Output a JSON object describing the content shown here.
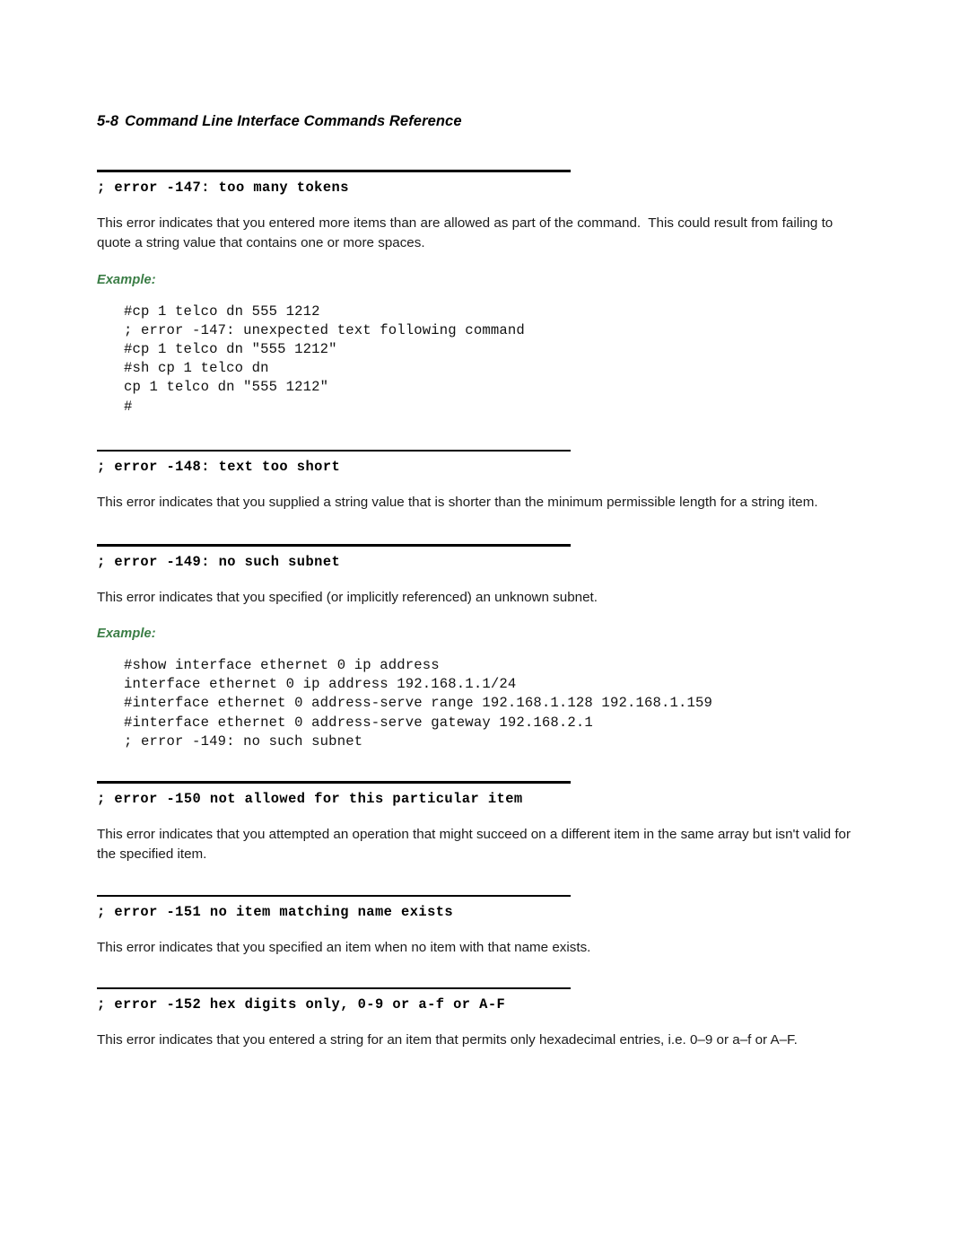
{
  "header": {
    "folio": "5-8",
    "title": "Command Line Interface Commands Reference"
  },
  "labels": {
    "example": "Example:"
  },
  "colors": {
    "example_green": "#3a7d45",
    "rule_black": "#000000",
    "body_text": "#1b1b1b"
  },
  "sections": [
    {
      "heading": "; error -147: too many tokens",
      "body": "This error indicates that you entered more items than are allowed as part of the command.  This could result from failing to quote a string value that contains one or more spaces.",
      "example_label": "Example:",
      "code": "#cp 1 telco dn 555 1212\n; error -147: unexpected text following command\n#cp 1 telco dn \"555 1212\"\n#sh cp 1 telco dn\ncp 1 telco dn \"555 1212\"\n#"
    },
    {
      "heading": "; error -148: text too short",
      "body": "This error indicates that you supplied a string value that is shorter than the minimum permissible length for a string item."
    },
    {
      "heading": "; error -149: no such subnet",
      "body": "This error indicates that you specified (or implicitly referenced) an unknown subnet.",
      "example_label": "Example:",
      "code": "#show interface ethernet 0 ip address\ninterface ethernet 0 ip address 192.168.1.1/24\n#interface ethernet 0 address-serve range 192.168.1.128 192.168.1.159\n#interface ethernet 0 address-serve gateway 192.168.2.1\n; error -149: no such subnet"
    },
    {
      "heading": "; error -150 not allowed for this particular item",
      "body": "This error indicates that you attempted an operation that might succeed on a different item in the same array but isn't valid for the specified item."
    },
    {
      "heading": "; error -151 no item matching name exists",
      "body": "This error indicates that you specified an item when no item with that name exists."
    },
    {
      "heading": "; error -152 hex digits only, 0-9 or a-f or A-F",
      "body": "This error indicates that you entered a string for an item that permits only hexadecimal entries, i.e. 0–9 or a–f or A–F."
    }
  ]
}
